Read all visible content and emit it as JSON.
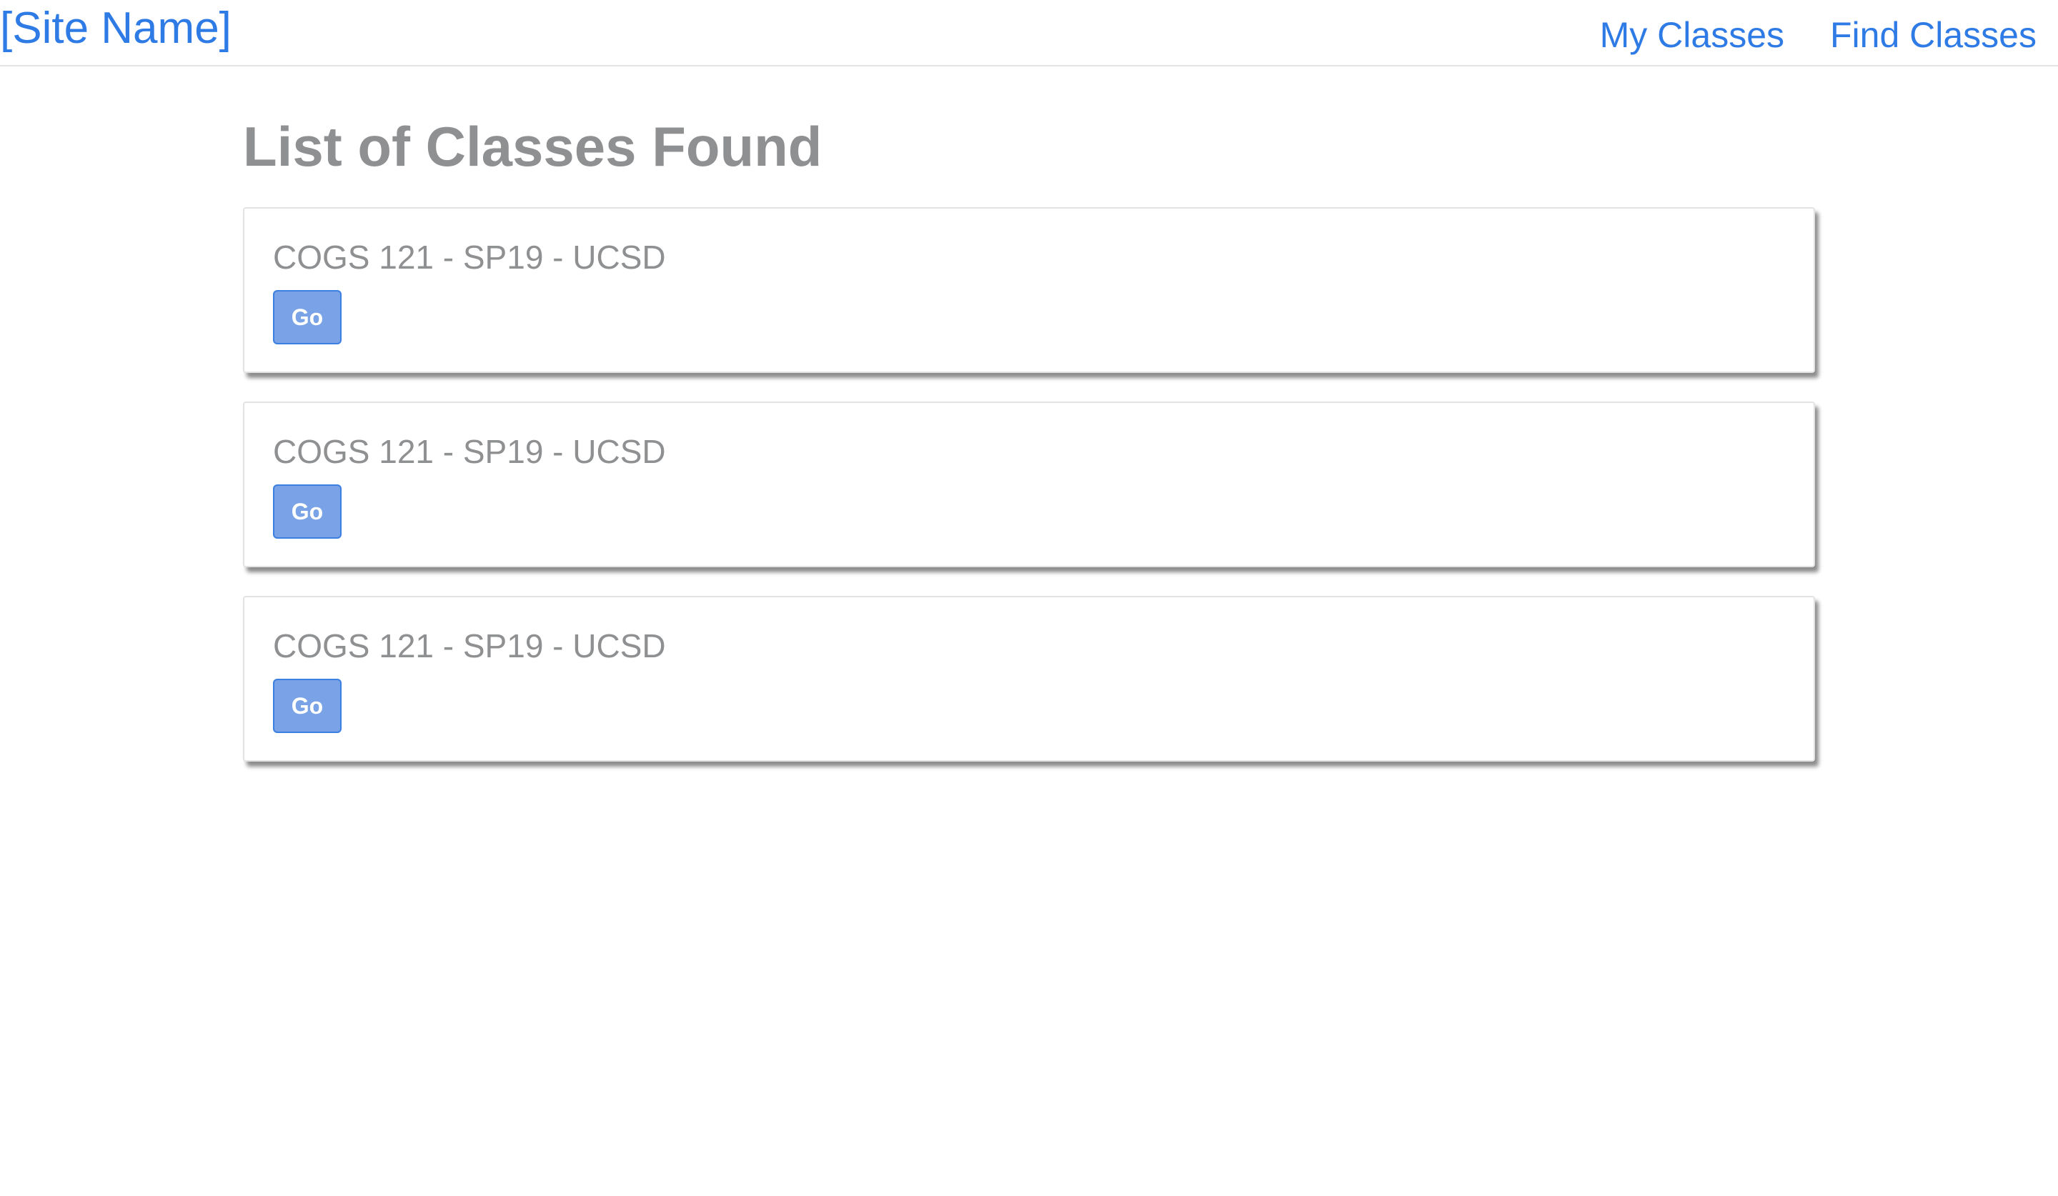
{
  "header": {
    "site_name": "[Site Name]",
    "nav": [
      {
        "label": "My Classes"
      },
      {
        "label": "Find Classes"
      }
    ]
  },
  "main": {
    "title": "List of Classes Found",
    "classes": [
      {
        "name": "COGS 121 - SP19 - UCSD",
        "button_label": "Go"
      },
      {
        "name": "COGS 121 - SP19 - UCSD",
        "button_label": "Go"
      },
      {
        "name": "COGS 121 - SP19 - UCSD",
        "button_label": "Go"
      }
    ]
  },
  "colors": {
    "link": "#2f7be6",
    "text_muted": "#8f9092",
    "button_bg": "#7aa2e6",
    "button_border": "#3b7fe0"
  }
}
